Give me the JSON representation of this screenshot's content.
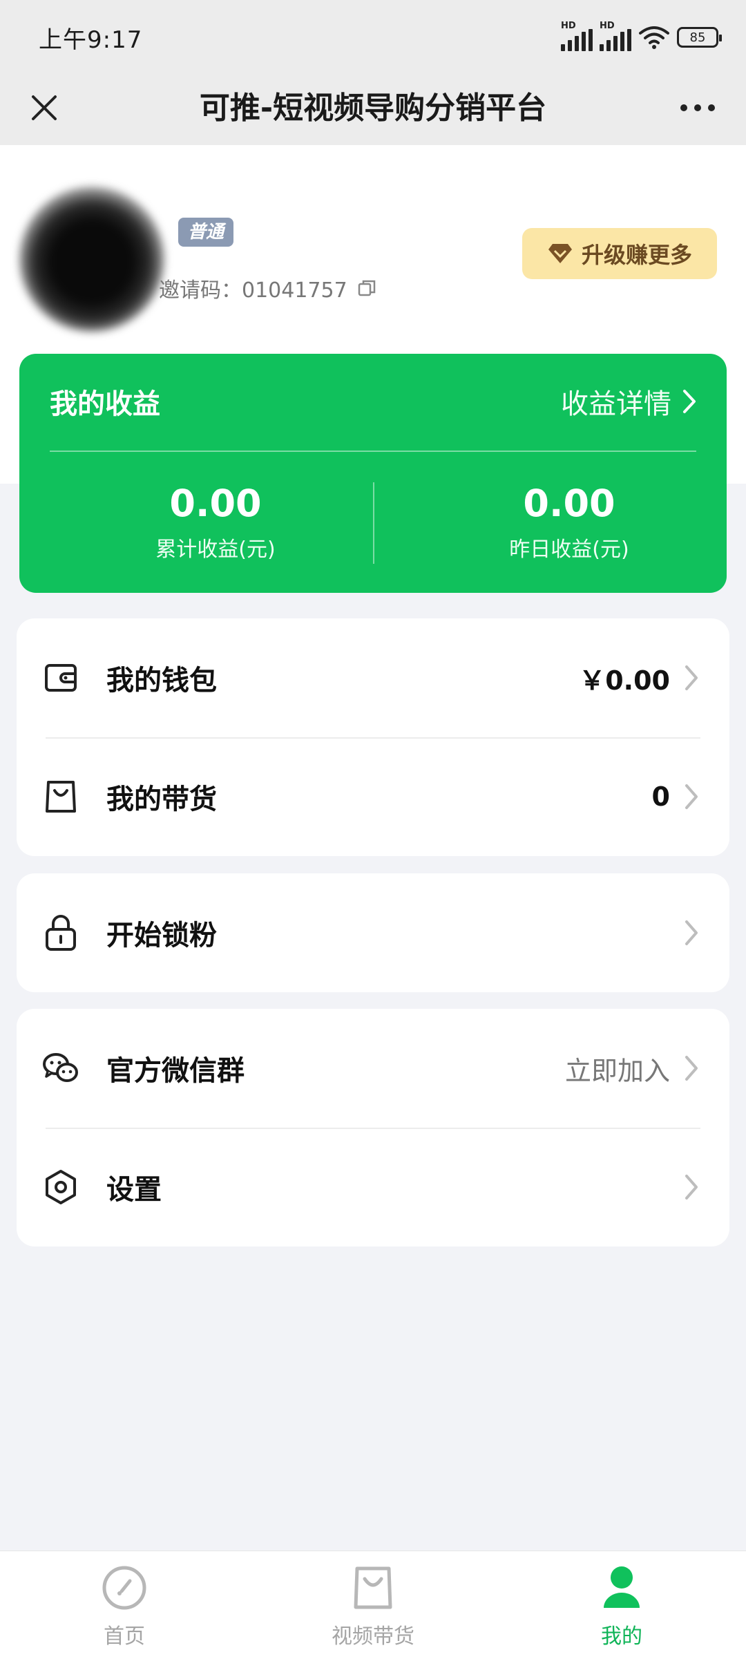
{
  "status_bar": {
    "time": "上午9:17",
    "battery": "85",
    "signal_tag": "HD"
  },
  "title_bar": {
    "title": "可推-短视频导购分销平台"
  },
  "profile": {
    "level_badge": "普通",
    "invite_label": "邀请码：",
    "invite_code": "01041757",
    "upgrade_label": "升级赚更多"
  },
  "earnings": {
    "title": "我的收益",
    "detail_label": "收益详情",
    "total_value": "0.00",
    "total_label": "累计收益(元)",
    "yesterday_value": "0.00",
    "yesterday_label": "昨日收益(元)"
  },
  "menu": {
    "wallet": {
      "label": "我的钱包",
      "value": "￥0.00"
    },
    "goods": {
      "label": "我的带货",
      "value": "0"
    },
    "lock_fans": {
      "label": "开始锁粉"
    },
    "wechat_group": {
      "label": "官方微信群",
      "value": "立即加入"
    },
    "settings": {
      "label": "设置"
    }
  },
  "bottom_nav": {
    "tabs": [
      {
        "label": "首页",
        "icon": "compass-icon"
      },
      {
        "label": "视频带货",
        "icon": "shopping-bag-icon"
      },
      {
        "label": "我的",
        "icon": "user-icon"
      }
    ],
    "active_color": "#10b458",
    "accent_green": "#10c15c"
  }
}
